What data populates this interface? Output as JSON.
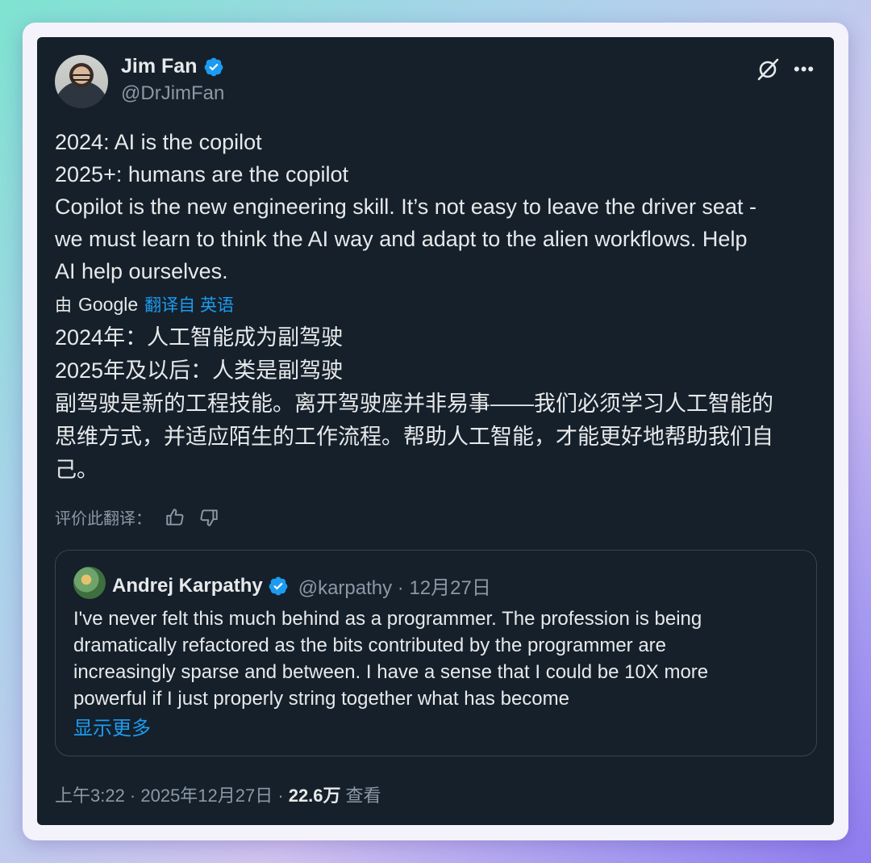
{
  "author": {
    "name": "Jim Fan",
    "handle": "@DrJimFan"
  },
  "tweet": {
    "text": "2024: AI is the copilot\n2025+: humans are the copilot\nCopilot is the new engineering skill. It’s not easy to leave the driver seat -\nwe must learn to think the AI way and adapt to the alien workflows. Help\nAI help ourselves.",
    "translated_by": "由",
    "translator": "Google",
    "translate_link": "翻译自 英语",
    "translation": "2024年：人工智能成为副驾驶\n2025年及以后：人类是副驾驶\n副驾驶是新的工程技能。离开驾驶座并非易事——我们必须学习人工智能的\n思维方式，并适应陌生的工作流程。帮助人工智能，才能更好地帮助我们自\n己。",
    "rate_label": "评价此翻译："
  },
  "quote": {
    "name": "Andrej Karpathy",
    "meta": "@karpathy · 12月27日",
    "text": "I've never felt this much behind as a programmer. The profession is being\ndramatically refactored as the bits contributed by the programmer are\nincreasingly sparse and between. I have a sense that I could be 10X more\npowerful if I just properly string together what has become",
    "show_more": "显示更多"
  },
  "footer": {
    "timestamp": "上午3:22 · 2025年12月27日 ·",
    "views_count": "22.6万",
    "views_label": "查看"
  },
  "colors": {
    "background": "#15202b",
    "accent": "#1d9bf0",
    "muted": "#8b98a5",
    "text": "#e7e9ea"
  }
}
